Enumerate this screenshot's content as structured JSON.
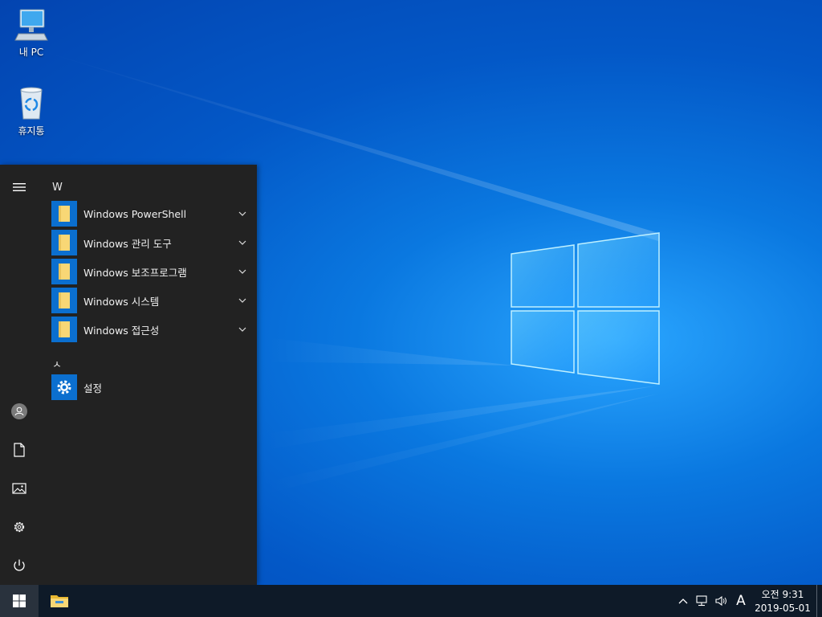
{
  "desktop": {
    "icons": [
      {
        "label": "내 PC",
        "icon": "this-pc-icon"
      },
      {
        "label": "휴지통",
        "icon": "recycle-bin-icon"
      }
    ]
  },
  "start_menu": {
    "rail": {
      "items": [
        {
          "name": "hamburger-menu-icon"
        },
        {
          "name": "user-avatar-icon"
        },
        {
          "name": "documents-icon"
        },
        {
          "name": "pictures-icon"
        },
        {
          "name": "settings-gear-icon"
        },
        {
          "name": "power-icon"
        }
      ]
    },
    "groups": [
      {
        "letter": "W",
        "apps": [
          {
            "label": "Windows PowerShell",
            "icon": "folder-icon",
            "expandable": true
          },
          {
            "label": "Windows 관리 도구",
            "icon": "folder-icon",
            "expandable": true
          },
          {
            "label": "Windows 보조프로그램",
            "icon": "folder-icon",
            "expandable": true
          },
          {
            "label": "Windows 시스템",
            "icon": "folder-icon",
            "expandable": true
          },
          {
            "label": "Windows 접근성",
            "icon": "folder-icon",
            "expandable": true
          }
        ]
      },
      {
        "letter": "ㅅ",
        "apps": [
          {
            "label": "설정",
            "icon": "settings-gear-icon",
            "expandable": false
          }
        ]
      }
    ]
  },
  "taskbar": {
    "pinned": [
      {
        "name": "file-explorer-icon"
      }
    ],
    "tray": {
      "ime_indicator": "A",
      "time": "오전 9:31",
      "date": "2019-05-01"
    }
  },
  "colors": {
    "start_bg": "#222222",
    "tile_accent": "#0b6fcf",
    "taskbar_bg": "#0e1a28"
  }
}
